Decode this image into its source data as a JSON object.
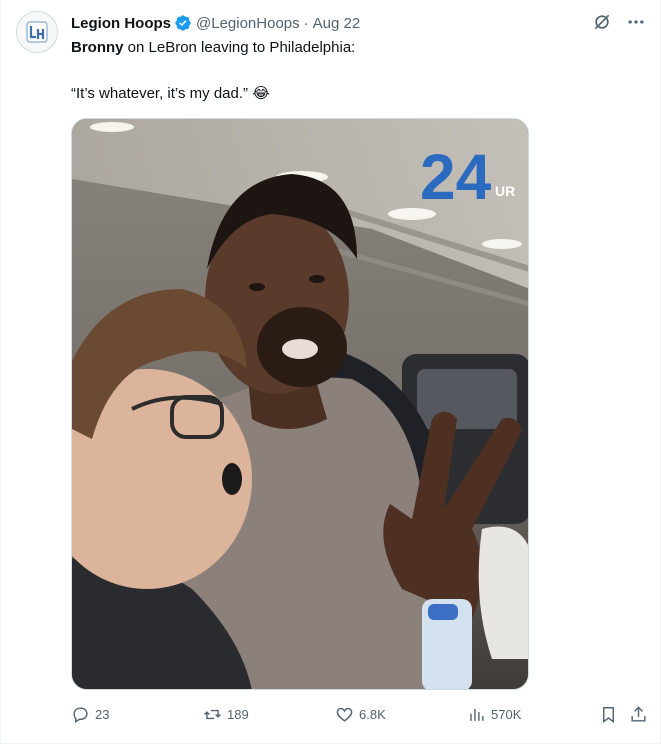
{
  "author": {
    "name": "Legion Hoops",
    "handle": "@LegionHoops",
    "separator": "·",
    "date": "Aug 22",
    "avatar_icon": "legion-hoops-logo-icon",
    "verified_color": "#1d9bf0"
  },
  "tweet": {
    "line1_bold": "Bronny",
    "line1_rest": " on LeBron leaving to Philadelphia:",
    "quote": "“It’s whatever, it’s my dad.”",
    "emoji": "😂"
  },
  "media": {
    "watermark_number": "24",
    "watermark_suffix": "UR",
    "watermark_color": "#2a6bbf"
  },
  "actions": {
    "replies": "23",
    "reposts": "189",
    "likes": "6.8K",
    "views": "570K"
  },
  "icons": {
    "grok": "grok-icon",
    "more": "more-icon",
    "reply": "reply-icon",
    "repost": "repost-icon",
    "like": "heart-icon",
    "views": "views-icon",
    "bookmark": "bookmark-icon",
    "share": "share-icon"
  }
}
